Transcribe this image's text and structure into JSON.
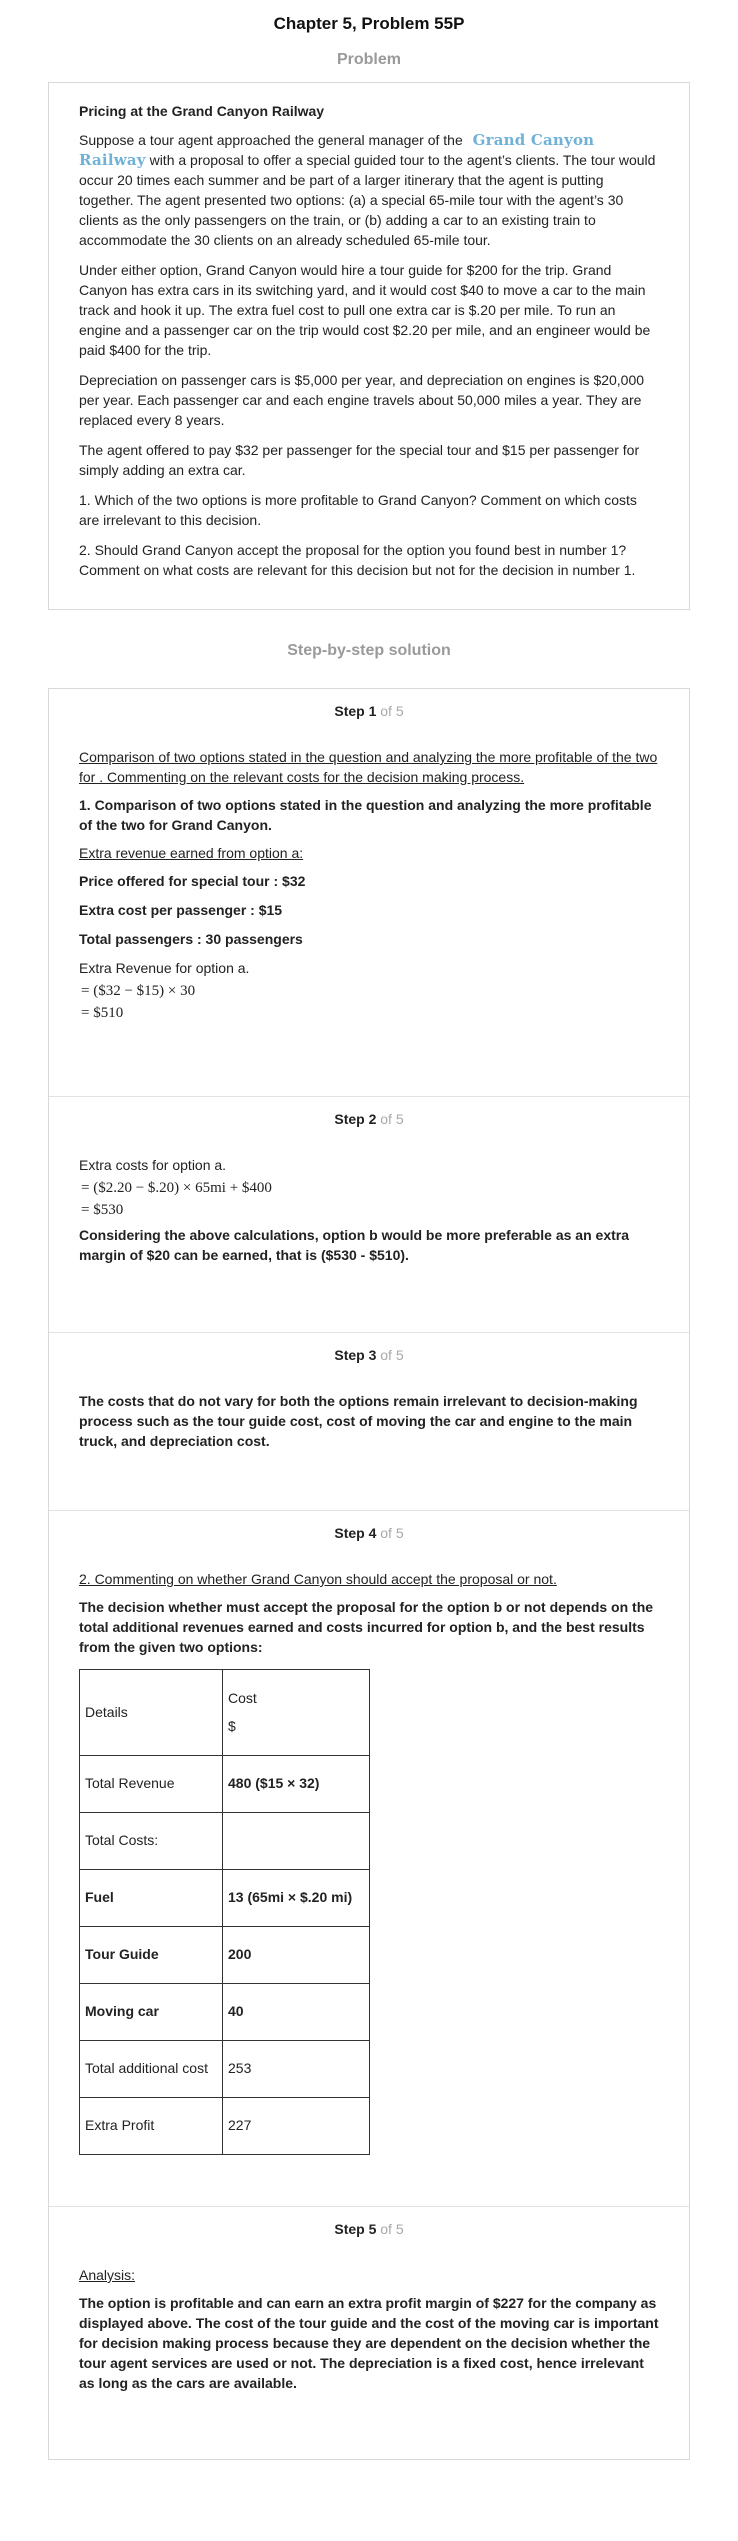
{
  "header": {
    "title": "Chapter 5, Problem 55P",
    "problem_heading": "Problem"
  },
  "problem": {
    "title": "Pricing at the Grand Canyon Railway",
    "p1_before": "Suppose a tour agent approached the general manager of the",
    "logo_text": "Grand Canyon Railway",
    "p1_after": " with a proposal to offer a special guided tour to the agent’s clients. The tour would occur 20 times each summer and be part of a larger itinerary that the agent is putting together. The agent presented two options: (a) a special 65-mile tour with the agent’s 30 clients as the only passengers on the train, or (b) adding a car to an existing train to accommodate the 30 clients on an already scheduled 65-mile tour.",
    "p2": "Under either option, Grand Canyon would hire a tour guide for $200 for the trip. Grand Canyon has extra cars in its switching yard, and it would cost $40 to move a car to the main track and hook it up. The extra fuel cost to pull one extra car is $.20 per mile. To run an engine and a passenger car on the trip would cost $2.20 per mile, and an engineer would be paid $400 for the trip.",
    "p3": "Depreciation on passenger cars is $5,000 per year, and depreciation on engines is $20,000 per year. Each passenger car and each engine travels about 50,000 miles a year. They are replaced every 8 years.",
    "p4": "The agent offered to pay $32 per passenger for the special tour and $15 per passenger for simply adding an extra car.",
    "q1": "1. Which of the two options is more profitable to Grand Canyon? Comment on which costs are irrelevant to this decision.",
    "q2": "2. Should Grand Canyon accept the proposal for the option you found best in number 1? Comment on what costs are relevant for this decision but not for the decision in number 1."
  },
  "solution_heading": "Step-by-step solution",
  "steps": {
    "s1": {
      "label": "Step 1",
      "of": " of 5",
      "underline_intro": "Comparison of two options stated in the question and analyzing the more profitable of the two for . Commenting on the relevant costs for the decision making process.",
      "bold_heading": "1. Comparison of two options stated in the question and analyzing the more profitable of the two for Grand Canyon.",
      "extra_revenue_heading": "Extra revenue earned from option a:",
      "price_line": "Price offered for special tour : $32",
      "cost_line": "Extra cost per passenger : $15",
      "passengers_line": "Total passengers : 30 passengers",
      "revenue_label": "Extra Revenue for option a.",
      "math1": "= ($32 − $15) × 30",
      "math2": "= $510"
    },
    "s2": {
      "label": "Step 2",
      "of": " of 5",
      "costs_label": "Extra costs for option a.",
      "math1": "= ($2.20 − $.20) × 65mi + $400",
      "math2": "= $530",
      "conclusion": "Considering the above calculations, option b would be more preferable as an extra margin of $20 can be earned, that is ($530 - $510)."
    },
    "s3": {
      "label": "Step 3",
      "of": " of 5",
      "text": "The costs that do not vary for both the options remain irrelevant to decision-making process such as the tour guide cost, cost of moving the car and engine to the main truck, and depreciation cost."
    },
    "s4": {
      "label": "Step 4",
      "of": " of 5",
      "underline_intro": "2. Commenting on whether Grand Canyon should accept the proposal or not.",
      "bold_text": "The decision whether must accept the proposal for the option b or not depends on the total additional revenues earned and costs incurred for option b, and the best results from the given two options:",
      "table": {
        "header_details": "Details",
        "header_cost": "Cost",
        "header_unit": "$",
        "rows": [
          {
            "label": "Total Revenue",
            "value": "480 ($15 × 32)"
          },
          {
            "label": "Total Costs:",
            "value": ""
          },
          {
            "label": "Fuel",
            "value": "13 (65mi × $.20 mi)"
          },
          {
            "label": "Tour Guide",
            "value": "200"
          },
          {
            "label": "Moving car",
            "value": "40"
          },
          {
            "label": "Total additional cost",
            "value": "253"
          },
          {
            "label": "Extra Profit",
            "value": "227"
          }
        ]
      }
    },
    "s5": {
      "label": "Step 5",
      "of": " of 5",
      "analysis_label": "Analysis:",
      "text": "The option is profitable and can earn an extra profit margin of $227 for the company as displayed above. The cost of the tour guide and the cost of the moving car is important for decision making process because they are dependent on the decision whether the tour agent services are used or not. The depreciation is a fixed cost, hence irrelevant as long as the cars are available."
    }
  }
}
